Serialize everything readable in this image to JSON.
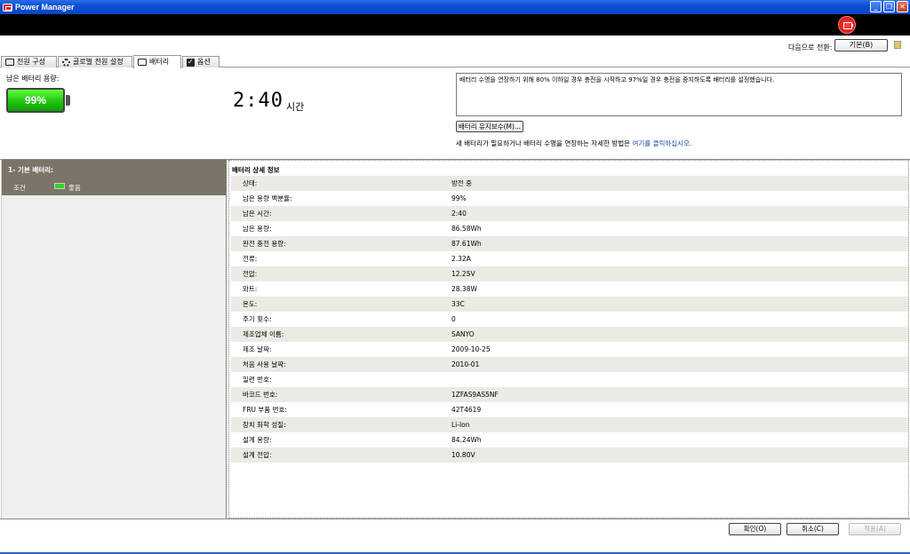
{
  "window": {
    "title": "Power Manager"
  },
  "switch": {
    "label": "다음으로 전환:",
    "button": "기본(B)"
  },
  "tabs": [
    {
      "label": "전원 구성"
    },
    {
      "label": "글로벌 전원 설정"
    },
    {
      "label": "배터리"
    },
    {
      "label": "옵션"
    }
  ],
  "summary": {
    "remaining_label": "남은 배터리 용량:",
    "percent": "99%",
    "percent_value": 99,
    "time": "2:40",
    "time_unit": "시간",
    "message": "배터리 수명을 연장하기 위해 80% 이하일 경우 충전을 시작하고 97%일 경우 충전을 중지하도록 배터리를 설정했습니다.",
    "maintenance_button": "배터리 유지보수(M)...",
    "help_prefix": "새 배터리가 필요하거나 배터리 수명을 연장하는 자세한 방법은 ",
    "help_link": "여기를 클릭하십시오."
  },
  "left": {
    "title": "1- 기본 배터리:",
    "condition_label": "조건",
    "condition_value": "좋음"
  },
  "details": {
    "title": "배터리 상세 정보",
    "rows": [
      {
        "label": "상태:",
        "value": "방전 중"
      },
      {
        "label": "남은 용량 백분율:",
        "value": "99%"
      },
      {
        "label": "남은 시간:",
        "value": "2:40"
      },
      {
        "label": "남은 용량:",
        "value": "86.58Wh"
      },
      {
        "label": "완전 충전 용량:",
        "value": "87.61Wh"
      },
      {
        "label": "전류:",
        "value": "2.32A"
      },
      {
        "label": "전압:",
        "value": "12.25V"
      },
      {
        "label": "와트:",
        "value": "28.38W"
      },
      {
        "label": "온도:",
        "value": "33C"
      },
      {
        "label": "주기 횟수:",
        "value": "0"
      },
      {
        "label": "제조업체 이름:",
        "value": "SANYO"
      },
      {
        "label": "제조 날짜:",
        "value": "2009-10-25"
      },
      {
        "label": "처음 사용 날짜:",
        "value": "2010-01"
      },
      {
        "label": "일련 번호:",
        "value": ""
      },
      {
        "label": "바코드 번호:",
        "value": "1ZFAS9AS5NF"
      },
      {
        "label": "FRU 부품 번호:",
        "value": "42T4619"
      },
      {
        "label": "장치 화학 성질:",
        "value": "Li-Ion"
      },
      {
        "label": "설계 용량:",
        "value": "84.24Wh"
      },
      {
        "label": "설계 전압:",
        "value": "10.80V"
      }
    ]
  },
  "buttons": {
    "ok": "확인(O)",
    "cancel": "취소(C)",
    "apply": "적용(A)"
  }
}
